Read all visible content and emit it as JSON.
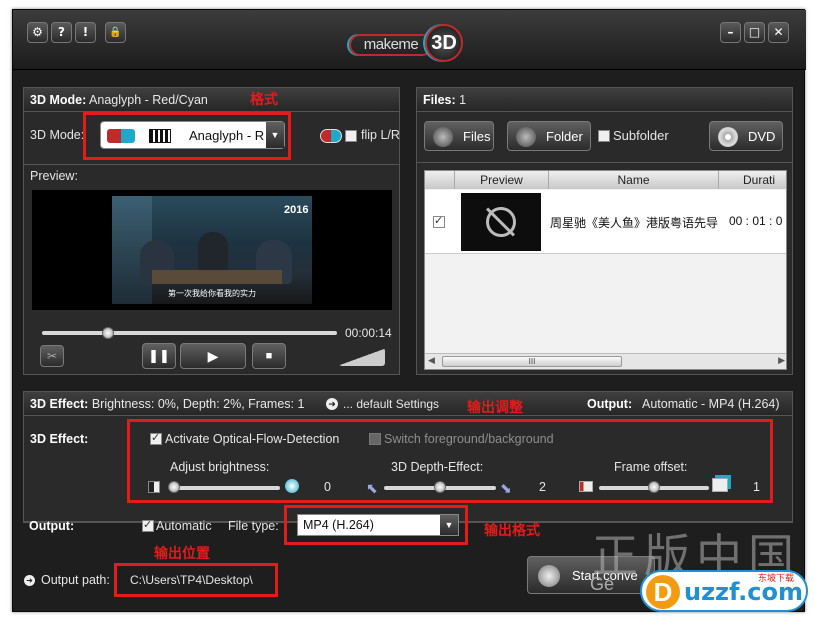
{
  "titlebar": {
    "left_buttons": [
      "⚙",
      "?",
      "!",
      "🔒"
    ],
    "logo_text": "makeme",
    "logo_3d": "3D",
    "window_buttons": [
      "–",
      "□",
      "✕"
    ]
  },
  "mode_panel": {
    "header_label": "3D Mode:",
    "header_value": "Anaglyph - Red/Cyan",
    "mode_label": "3D Mode:",
    "mode_select_value": "Anaglyph - R",
    "flip_label": "flip L/R",
    "preview_label": "Preview:",
    "time": "00:00:14",
    "subtitle": "第一次我给你看我的实力",
    "poster_text": "2016"
  },
  "files_panel": {
    "header_label": "Files:",
    "header_count": "1",
    "files_button": "Files",
    "folder_button": "Folder",
    "subfolder_label": "Subfolder",
    "dvd_button": "DVD",
    "columns": [
      "Preview",
      "Name",
      "Durati"
    ],
    "rows": [
      {
        "name": "周星驰《美人鱼》港版粤语先导",
        "duration": "00 : 01 : 0"
      }
    ],
    "scroll_grip": "III"
  },
  "effect_panel": {
    "header_label": "3D Effect:",
    "header_value": "Brightness: 0%, Depth: 2%, Frames: 1",
    "default_settings": "... default Settings",
    "output_label": "Output:",
    "output_value": "Automatic - MP4 (H.264)",
    "effect_label": "3D Effect:",
    "optical_flow_label": "Activate Optical-Flow-Detection",
    "switch_label": "Switch foreground/background",
    "brightness_label": "Adjust brightness:",
    "brightness_value": "0",
    "brightness_level": 0,
    "depth_label": "3D Depth-Effect:",
    "depth_value": "2",
    "depth_level": 0.5,
    "frame_label": "Frame offset:",
    "frame_value": "1",
    "frame_level": 0.5,
    "output_row_label": "Output:",
    "automatic_label": "Automatic",
    "filetype_label": "File type:",
    "filetype_value": "MP4 (H.264)",
    "output_path_label": "Output path:",
    "output_path_value": "C:\\Users\\TP4\\Desktop\\",
    "start_button": "Start conve"
  },
  "annotations": {
    "format": "格式",
    "output_adjust": "输出调整",
    "output_format": "输出格式",
    "output_location": "输出位置"
  },
  "watermark": {
    "text": "正版中国",
    "sub": "Ge",
    "site": "uzzf.com",
    "site_tag": "东坡下载"
  },
  "colors": {
    "annotation_red": "#e41b1b",
    "anaglyph_red": "#c02a2a",
    "anaglyph_cyan": "#1fa9c9"
  }
}
